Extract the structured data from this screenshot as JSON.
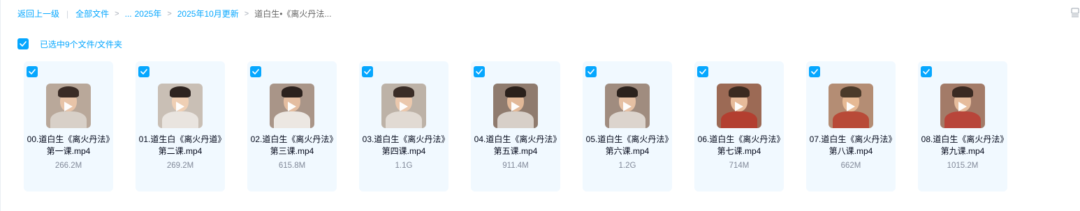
{
  "breadcrumb": {
    "back": "返回上一级",
    "all_files": "全部文件",
    "ellipsis": "...",
    "year": "2025年",
    "month": "2025年10月更新",
    "current": "道白生•《离火丹法..."
  },
  "icons": {
    "checkbox": "checkmark-icon",
    "play": "play-icon",
    "view_toggle": "view-toggle-icon",
    "separator": "chevron-right-icon"
  },
  "colors": {
    "accent": "#06a7ff",
    "card_bg": "#f1f9ff",
    "name": "#03081a",
    "size": "#818999"
  },
  "selection": {
    "label": "已选中9个文件/文件夹",
    "checked": true
  },
  "files": [
    {
      "name": "00.道白生《离火丹法》第一课.mp4",
      "size": "266.2M",
      "checked": true
    },
    {
      "name": "01.道生白《离火丹道》第二课.mp4",
      "size": "269.2M",
      "checked": true
    },
    {
      "name": "02.道白生《离火丹法》第三课.mp4",
      "size": "615.8M",
      "checked": true
    },
    {
      "name": "03.道白生《离火丹法》第四课.mp4",
      "size": "1.1G",
      "checked": true
    },
    {
      "name": "04.道白生《离火丹法》第五课.mp4",
      "size": "911.4M",
      "checked": true
    },
    {
      "name": "05.道白生《离火丹法》第六课.mp4",
      "size": "1.2G",
      "checked": true
    },
    {
      "name": "06.道白生《离火丹法》第七课.mp4",
      "size": "714M",
      "checked": true
    },
    {
      "name": "07.道白生《离火丹法》第八课.mp4",
      "size": "662M",
      "checked": true
    },
    {
      "name": "08.道白生《离火丹法》第九课.mp4",
      "size": "1015.2M",
      "checked": true
    }
  ]
}
